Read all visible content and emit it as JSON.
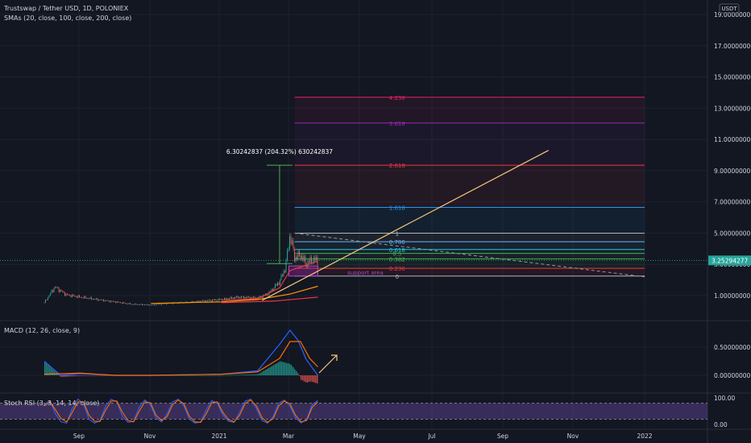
{
  "header": {
    "symbol_line": "Trustswap / Tether USD, 1D, POLONIEX",
    "sma_line": "SMAs (20, close, 100, close, 200, close)",
    "macd_line": "MACD (12, 26, close, 9)",
    "stoch_line": "Stoch RSI (3, 3, 14, 14, close)"
  },
  "currency_badge": "USDT",
  "last_price_label": "3.25294277",
  "measure_label": "6.30242837 (204.32%) 630242837",
  "support_label": "support area",
  "colors": {
    "background": "#131722",
    "grid": "#1e2230",
    "text": "#d1d4dc",
    "up": "#26a69a",
    "down": "#ef5350",
    "sma_red": "#f23645",
    "sma_orange": "#ff9800",
    "trendline": "#f7c77a",
    "macd_line": "#2962ff",
    "signal_line": "#ff6d00",
    "stoch_k": "#2962ff",
    "stoch_d": "#ff6d00",
    "stoch_band": "#7e57c2",
    "fib_purple": "#9c27b0",
    "measure": "#4caf50",
    "price_badge": "#26a69a"
  },
  "chart_data": [
    {
      "type": "line",
      "title": "Trustswap / Tether USD, 1D, POLONIEX",
      "y_axis_ticks": [
        "19.00000000",
        "17.00000000",
        "15.00000000",
        "13.00000000",
        "11.00000000",
        "9.00000000",
        "7.00000000",
        "5.00000000",
        "3.00000000",
        "1.00000000"
      ],
      "x_axis_ticks": [
        "Sep",
        "Nov",
        "2021",
        "Mar",
        "May",
        "Jul",
        "Sep",
        "Nov",
        "2022"
      ],
      "ylim": [
        -0.6,
        20
      ],
      "price_close": {
        "x": [
          "2020-08-01",
          "2020-08-10",
          "2020-08-20",
          "2020-09-01",
          "2020-09-15",
          "2020-10-01",
          "2020-10-15",
          "2020-11-01",
          "2020-11-15",
          "2020-12-01",
          "2020-12-15",
          "2021-01-01",
          "2021-01-15",
          "2021-02-01",
          "2021-02-10",
          "2021-02-20",
          "2021-02-25",
          "2021-03-01",
          "2021-03-05",
          "2021-03-10",
          "2021-03-15",
          "2021-03-20",
          "2021-03-25"
        ],
        "y": [
          0.55,
          1.55,
          1.05,
          0.9,
          0.75,
          0.6,
          0.45,
          0.4,
          0.5,
          0.55,
          0.65,
          0.75,
          0.9,
          0.85,
          1.1,
          1.9,
          2.8,
          4.9,
          3.4,
          3.6,
          3.0,
          3.3,
          3.25
        ]
      },
      "sma_20": {
        "x": [
          "2021-01-01",
          "2021-02-01",
          "2021-02-20",
          "2021-03-01",
          "2021-03-25"
        ],
        "y": [
          0.7,
          0.8,
          1.5,
          2.6,
          3.2
        ]
      },
      "sma_100": {
        "x": [
          "2020-11-01",
          "2021-01-01",
          "2021-02-01",
          "2021-03-01",
          "2021-03-25"
        ],
        "y": [
          0.5,
          0.6,
          0.75,
          1.1,
          1.6
        ]
      },
      "sma_200": {
        "x": [
          "2021-01-01",
          "2021-02-15",
          "2021-03-25"
        ],
        "y": [
          0.55,
          0.65,
          0.9
        ]
      },
      "fib_levels": [
        {
          "label": "4.236",
          "value": 13.7,
          "color": "#e91e63"
        },
        {
          "label": "3.618",
          "value": 12.05,
          "color": "#9c27b0"
        },
        {
          "label": "2.618",
          "value": 9.35,
          "color": "#f23645"
        },
        {
          "label": "1.618",
          "value": 6.65,
          "color": "#2196f3"
        },
        {
          "label": "1",
          "value": 5.0,
          "color": "#b2b5be"
        },
        {
          "label": "0.786",
          "value": 4.45,
          "color": "#64b5f6"
        },
        {
          "label": "0.618",
          "value": 3.95,
          "color": "#26c6da"
        },
        {
          "label": "0.5",
          "value": 3.7,
          "color": "#4caf50"
        },
        {
          "label": "0.382",
          "value": 3.35,
          "color": "#4caf50"
        },
        {
          "label": "0.236",
          "value": 2.75,
          "color": "#f23645"
        },
        {
          "label": "0",
          "value": 2.25,
          "color": "#b2b5be"
        }
      ],
      "fib_range": {
        "x_start": "2021-03-05",
        "x_end": "2022-01-01"
      },
      "trendline": {
        "x": [
          "2021-02-05",
          "2021-10-10"
        ],
        "y": [
          0.7,
          10.3
        ]
      },
      "dashed_line": {
        "x": [
          "2021-03-05",
          "2022-01-01"
        ],
        "y": [
          5.0,
          2.2
        ]
      },
      "measure": {
        "x": "2021-02-20",
        "y_from": 3.05,
        "y_to": 9.35
      },
      "support_area": {
        "x_start": "2021-02-28",
        "x_end": "2021-03-25",
        "y_from": 2.25,
        "y_to": 2.9
      },
      "last_price": 3.25294277
    },
    {
      "type": "line",
      "title": "MACD (12, 26, close, 9)",
      "y_axis_ticks": [
        "0.50000000",
        "0.00000000"
      ],
      "ylim": [
        -0.45,
        1.25
      ],
      "macd": {
        "x": [
          "2020-08-01",
          "2020-08-15",
          "2020-09-01",
          "2020-10-01",
          "2020-11-01",
          "2020-12-01",
          "2021-01-01",
          "2021-02-01",
          "2021-02-20",
          "2021-03-01",
          "2021-03-08",
          "2021-03-15",
          "2021-03-25"
        ],
        "y": [
          0.25,
          0.0,
          0.03,
          0.0,
          0.0,
          0.01,
          0.02,
          0.08,
          0.55,
          0.8,
          0.62,
          0.28,
          0.0
        ]
      },
      "signal": {
        "x": [
          "2020-08-01",
          "2020-09-01",
          "2020-10-01",
          "2020-11-01",
          "2020-12-01",
          "2021-01-01",
          "2021-02-01",
          "2021-02-20",
          "2021-03-01",
          "2021-03-10",
          "2021-03-18",
          "2021-03-25"
        ],
        "y": [
          0.02,
          0.04,
          0.0,
          0.0,
          0.01,
          0.02,
          0.06,
          0.3,
          0.6,
          0.6,
          0.3,
          0.15
        ]
      }
    },
    {
      "type": "line",
      "title": "Stoch RSI (3, 3, 14, 14, close)",
      "y_axis_ticks": [
        "100.00",
        "0.00"
      ],
      "ylim": [
        -8,
        108
      ],
      "band": [
        20,
        80
      ],
      "k": {
        "x_start": "2020-08-01",
        "x_end": "2021-03-25",
        "values": [
          75,
          90,
          40,
          10,
          5,
          60,
          95,
          80,
          20,
          5,
          15,
          70,
          95,
          85,
          30,
          8,
          12,
          65,
          92,
          75,
          25,
          10,
          40,
          85,
          95,
          70,
          20,
          5,
          10,
          55,
          90,
          80,
          35,
          12,
          8,
          45,
          88,
          95,
          60,
          15,
          5,
          30,
          80,
          92,
          70,
          25,
          6,
          20,
          75,
          90
        ]
      },
      "d": {
        "x_start": "2020-08-01",
        "x_end": "2021-03-25",
        "values": [
          70,
          85,
          55,
          22,
          10,
          45,
          85,
          85,
          35,
          12,
          12,
          55,
          88,
          88,
          45,
          15,
          10,
          50,
          85,
          82,
          35,
          15,
          30,
          75,
          92,
          78,
          30,
          10,
          8,
          40,
          82,
          85,
          45,
          18,
          10,
          35,
          80,
          92,
          70,
          25,
          8,
          22,
          70,
          88,
          78,
          35,
          10,
          15,
          65,
          85
        ]
      }
    }
  ]
}
